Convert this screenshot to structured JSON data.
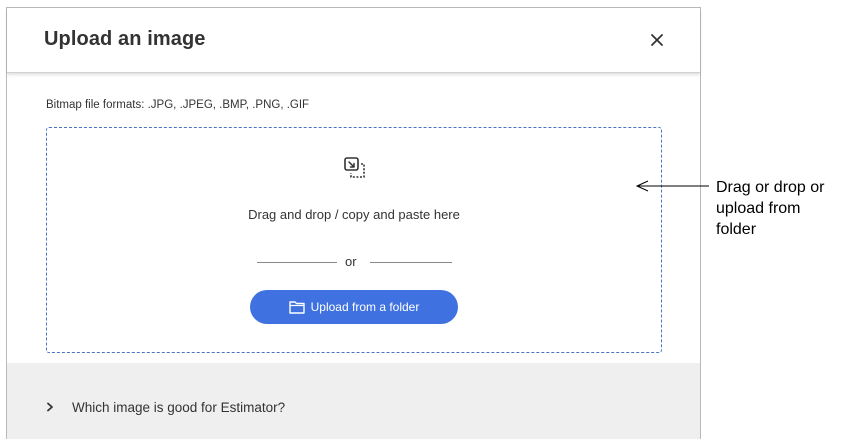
{
  "dialog": {
    "title": "Upload an image",
    "close_icon": "close-icon",
    "formats_label": "Bitmap file formats: .JPG, .JPEG, .BMP, .PNG, .GIF",
    "dropzone": {
      "icon": "drop-image-icon",
      "instructions": "Drag and drop / copy and paste here",
      "separator": "or",
      "upload_button_label": "Upload from a folder",
      "upload_button_icon": "folder-icon"
    },
    "accordion": {
      "label": "Which image is good for Estimator?",
      "icon": "chevron-right-icon"
    }
  },
  "annotation": {
    "lines": [
      "Drag or drop or",
      "upload from",
      "folder"
    ],
    "arrow_icon": "arrow-left-icon"
  },
  "colors": {
    "accent": "#3f72e0",
    "dropzone_border": "#4a73c4",
    "footer_bg": "#efefef",
    "text": "#333333"
  }
}
